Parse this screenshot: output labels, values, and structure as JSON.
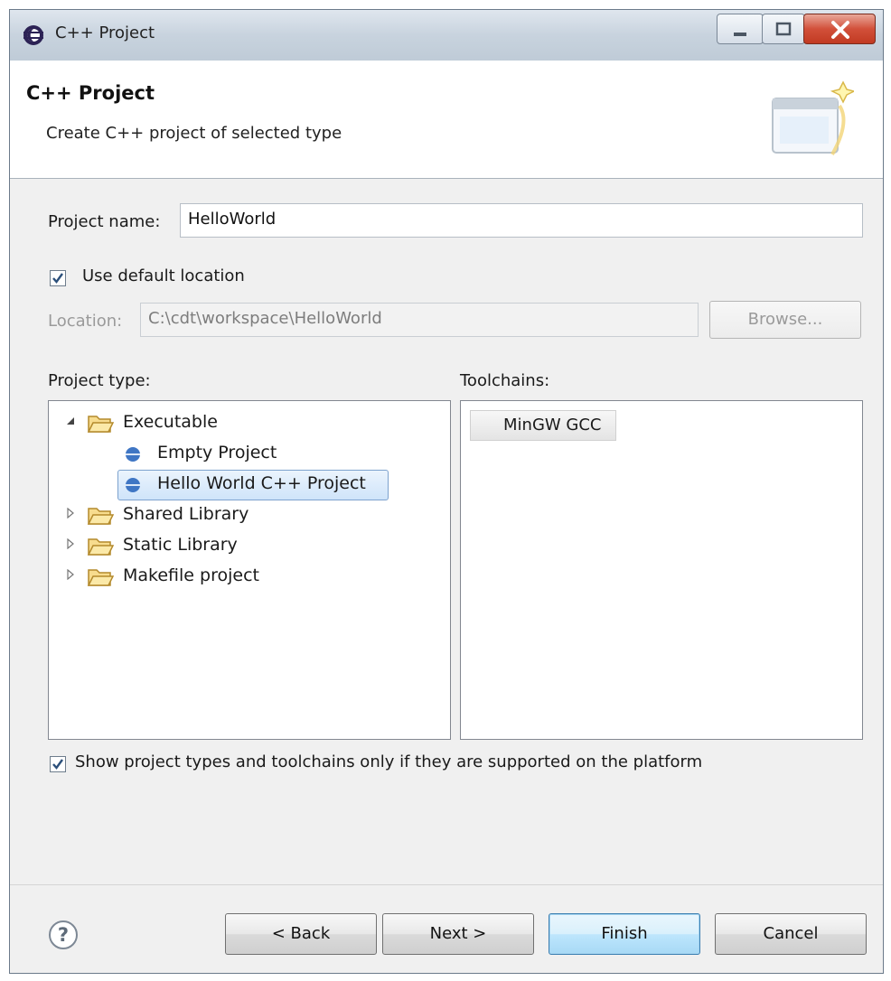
{
  "window": {
    "title": "C++ Project"
  },
  "header": {
    "title": "C++ Project",
    "subtitle": "Create C++ project of selected type"
  },
  "form": {
    "project_name_label": "Project name:",
    "project_name_value": "HelloWorld",
    "use_default_location_label": "Use default location",
    "use_default_location_checked": true,
    "location_label": "Location:",
    "location_value": "C:\\cdt\\workspace\\HelloWorld",
    "browse_label": "Browse..."
  },
  "project_types": {
    "label": "Project type:",
    "items": [
      {
        "label": "Executable",
        "expanded": true
      },
      {
        "label": "Empty Project"
      },
      {
        "label": "Hello World C++ Project",
        "selected": true
      },
      {
        "label": "Shared Library",
        "expanded": false
      },
      {
        "label": "Static Library",
        "expanded": false
      },
      {
        "label": "Makefile project",
        "expanded": false
      }
    ]
  },
  "toolchains": {
    "label": "Toolchains:",
    "items": [
      "MinGW GCC"
    ]
  },
  "filter": {
    "label": "Show project types and toolchains only if they are supported on the platform",
    "checked": true
  },
  "buttons": {
    "back": "< Back",
    "next": "Next >",
    "finish": "Finish",
    "cancel": "Cancel"
  },
  "colors": {
    "selection": "#cfe4fa",
    "primary_border": "#3c7fb1",
    "disabled_text": "#9a9a9a"
  }
}
